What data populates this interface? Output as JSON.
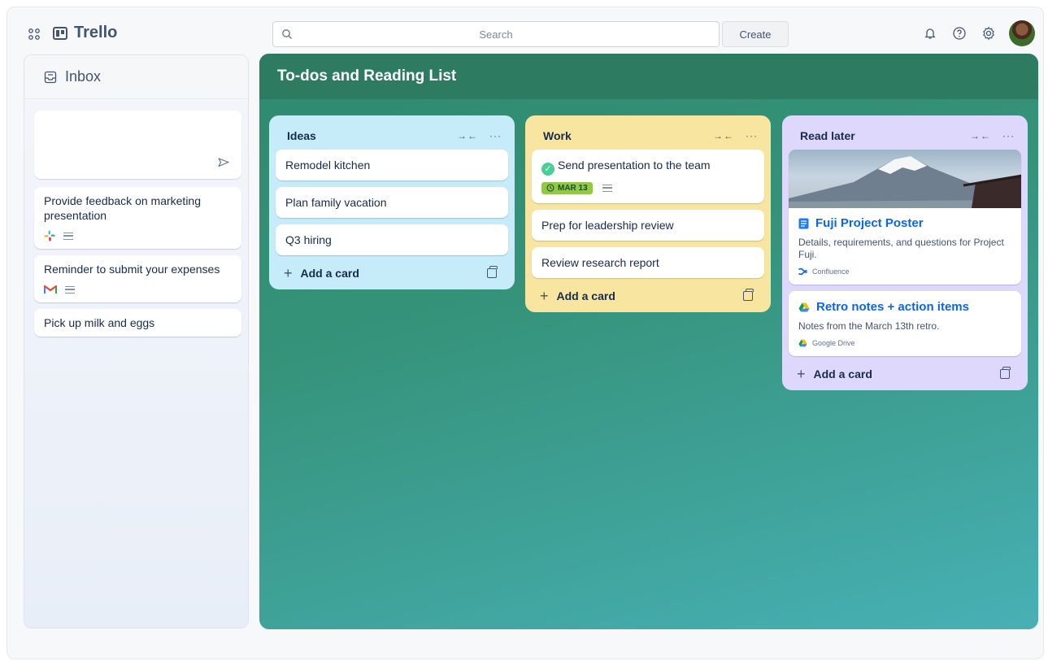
{
  "app": {
    "name": "Trello"
  },
  "search": {
    "placeholder": "Search"
  },
  "header": {
    "create_label": "Create"
  },
  "icons": {
    "apps": "apps-grid-icon",
    "logo": "trello-board-icon",
    "search": "search-icon",
    "bell": "bell-icon",
    "help": "help-icon",
    "settings": "gear-icon"
  },
  "inbox": {
    "title": "Inbox",
    "cards": [
      {
        "title": "Provide feedback on marketing presentation",
        "source_icon": "slack-icon"
      },
      {
        "title": "Reminder to submit your expenses",
        "source_icon": "gmail-icon"
      },
      {
        "title": "Pick up milk and eggs"
      }
    ]
  },
  "board": {
    "title": "To-dos and Reading List",
    "background_color": "#2e8a6d",
    "lists": [
      {
        "title": "Ideas",
        "color": "#c6ecfa",
        "cards": [
          "Remodel kitchen",
          "Plan family vacation",
          "Q3 hiring"
        ],
        "add_label": "Add a card"
      },
      {
        "title": "Work",
        "color": "#f8e6a0",
        "cards": [
          {
            "title": "Send presentation to the team",
            "completed": true,
            "due": "MAR 13"
          },
          {
            "title": "Prep for leadership review"
          },
          {
            "title": "Review research report"
          }
        ],
        "add_label": "Add a card"
      },
      {
        "title": "Read later",
        "color": "#dfd8fd",
        "cards": [
          {
            "title": "Fuji Project Poster",
            "description": "Details, requirements, and questions for Project Fuji.",
            "source": "Confluence"
          },
          {
            "title": "Retro notes + action items",
            "description": "Notes from the March 13th retro.",
            "source": "Google Drive"
          }
        ],
        "add_label": "Add a card"
      }
    ]
  }
}
